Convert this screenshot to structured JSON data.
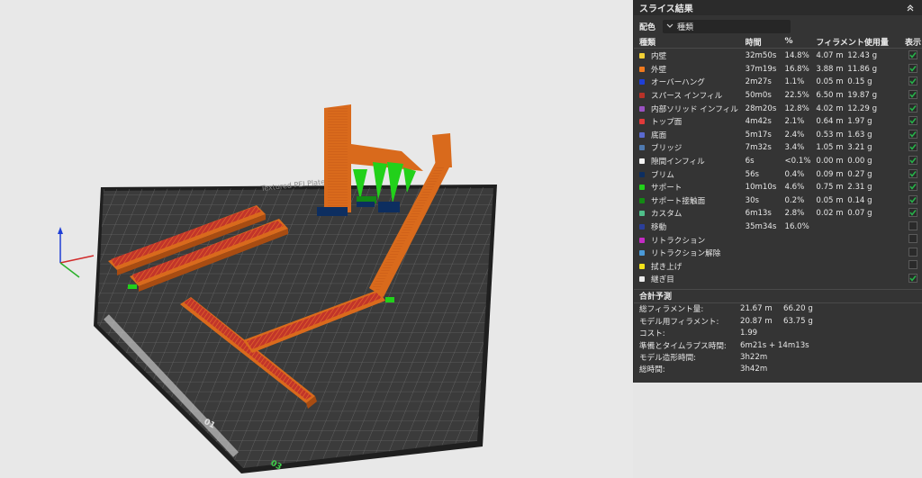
{
  "panel": {
    "title": "スライス結果",
    "color_label": "配色",
    "color_scheme": "種類",
    "headers": {
      "type": "種類",
      "time": "時間",
      "percent": "%",
      "filament": "フィラメント使用量",
      "show": "表示"
    },
    "rows": [
      {
        "name": "内壁",
        "color": "#f2d036",
        "time": "32m50s",
        "pct": "14.8%",
        "len": "4.07 m",
        "wt": "12.43 g",
        "shown": true
      },
      {
        "name": "外壁",
        "color": "#f07a1e",
        "time": "37m19s",
        "pct": "16.8%",
        "len": "3.88 m",
        "wt": "11.86 g",
        "shown": true
      },
      {
        "name": "オーバーハング",
        "color": "#1f3fd6",
        "time": "2m27s",
        "pct": "1.1%",
        "len": "0.05 m",
        "wt": "0.15 g",
        "shown": true
      },
      {
        "name": "スパース インフィル",
        "color": "#b83228",
        "time": "50m0s",
        "pct": "22.5%",
        "len": "6.50 m",
        "wt": "19.87 g",
        "shown": true
      },
      {
        "name": "内部ソリッド インフィル",
        "color": "#9a52c2",
        "time": "28m20s",
        "pct": "12.8%",
        "len": "4.02 m",
        "wt": "12.29 g",
        "shown": true
      },
      {
        "name": "トップ面",
        "color": "#e03a3a",
        "time": "4m42s",
        "pct": "2.1%",
        "len": "0.64 m",
        "wt": "1.97 g",
        "shown": true
      },
      {
        "name": "底面",
        "color": "#5a6ad0",
        "time": "5m17s",
        "pct": "2.4%",
        "len": "0.53 m",
        "wt": "1.63 g",
        "shown": true
      },
      {
        "name": "ブリッジ",
        "color": "#4f7ab0",
        "time": "7m32s",
        "pct": "3.4%",
        "len": "1.05 m",
        "wt": "3.21 g",
        "shown": true
      },
      {
        "name": "隙間インフィル",
        "color": "#f4f4f4",
        "time": "6s",
        "pct": "<0.1%",
        "len": "0.00 m",
        "wt": "0.00 g",
        "shown": true
      },
      {
        "name": "ブリム",
        "color": "#0d2e60",
        "time": "56s",
        "pct": "0.4%",
        "len": "0.09 m",
        "wt": "0.27 g",
        "shown": true
      },
      {
        "name": "サポート",
        "color": "#22d11a",
        "time": "10m10s",
        "pct": "4.6%",
        "len": "0.75 m",
        "wt": "2.31 g",
        "shown": true
      },
      {
        "name": "サポート接触面",
        "color": "#138a14",
        "time": "30s",
        "pct": "0.2%",
        "len": "0.05 m",
        "wt": "0.14 g",
        "shown": true
      },
      {
        "name": "カスタム",
        "color": "#4fbf8a",
        "time": "6m13s",
        "pct": "2.8%",
        "len": "0.02 m",
        "wt": "0.07 g",
        "shown": true
      },
      {
        "name": "移動",
        "color": "#2b3f9a",
        "time": "35m34s",
        "pct": "16.0%",
        "len": "",
        "wt": "",
        "shown": false
      },
      {
        "name": "リトラクション",
        "color": "#c42bc4",
        "time": "",
        "pct": "",
        "len": "",
        "wt": "",
        "shown": false
      },
      {
        "name": "リトラクション解除",
        "color": "#4a9ad8",
        "time": "",
        "pct": "",
        "len": "",
        "wt": "",
        "shown": false
      },
      {
        "name": "拭き上げ",
        "color": "#f2e21a",
        "time": "",
        "pct": "",
        "len": "",
        "wt": "",
        "shown": false
      },
      {
        "name": "継ぎ目",
        "color": "#eaeaea",
        "time": "",
        "pct": "",
        "len": "",
        "wt": "",
        "shown": true
      }
    ],
    "summary": {
      "title": "合計予測",
      "rows": [
        {
          "label": "総フィラメント量:",
          "v1": "21.67 m",
          "v2": "66.20 g"
        },
        {
          "label": "モデル用フィラメント:",
          "v1": "20.87 m",
          "v2": "63.75 g"
        },
        {
          "label": "コスト:",
          "v1": "1.99",
          "v2": ""
        },
        {
          "label": "準備とタイムラプス時間:",
          "v1": "6m21s + 14m13s",
          "v2": ""
        },
        {
          "label": "モデル造形時間:",
          "v1": "3h22m",
          "v2": ""
        },
        {
          "label": "総時間:",
          "v1": "3h42m",
          "v2": ""
        }
      ]
    }
  },
  "plate": {
    "bed_label": "Textured PEI Plate",
    "corner_label": "01",
    "number_label": "03"
  }
}
